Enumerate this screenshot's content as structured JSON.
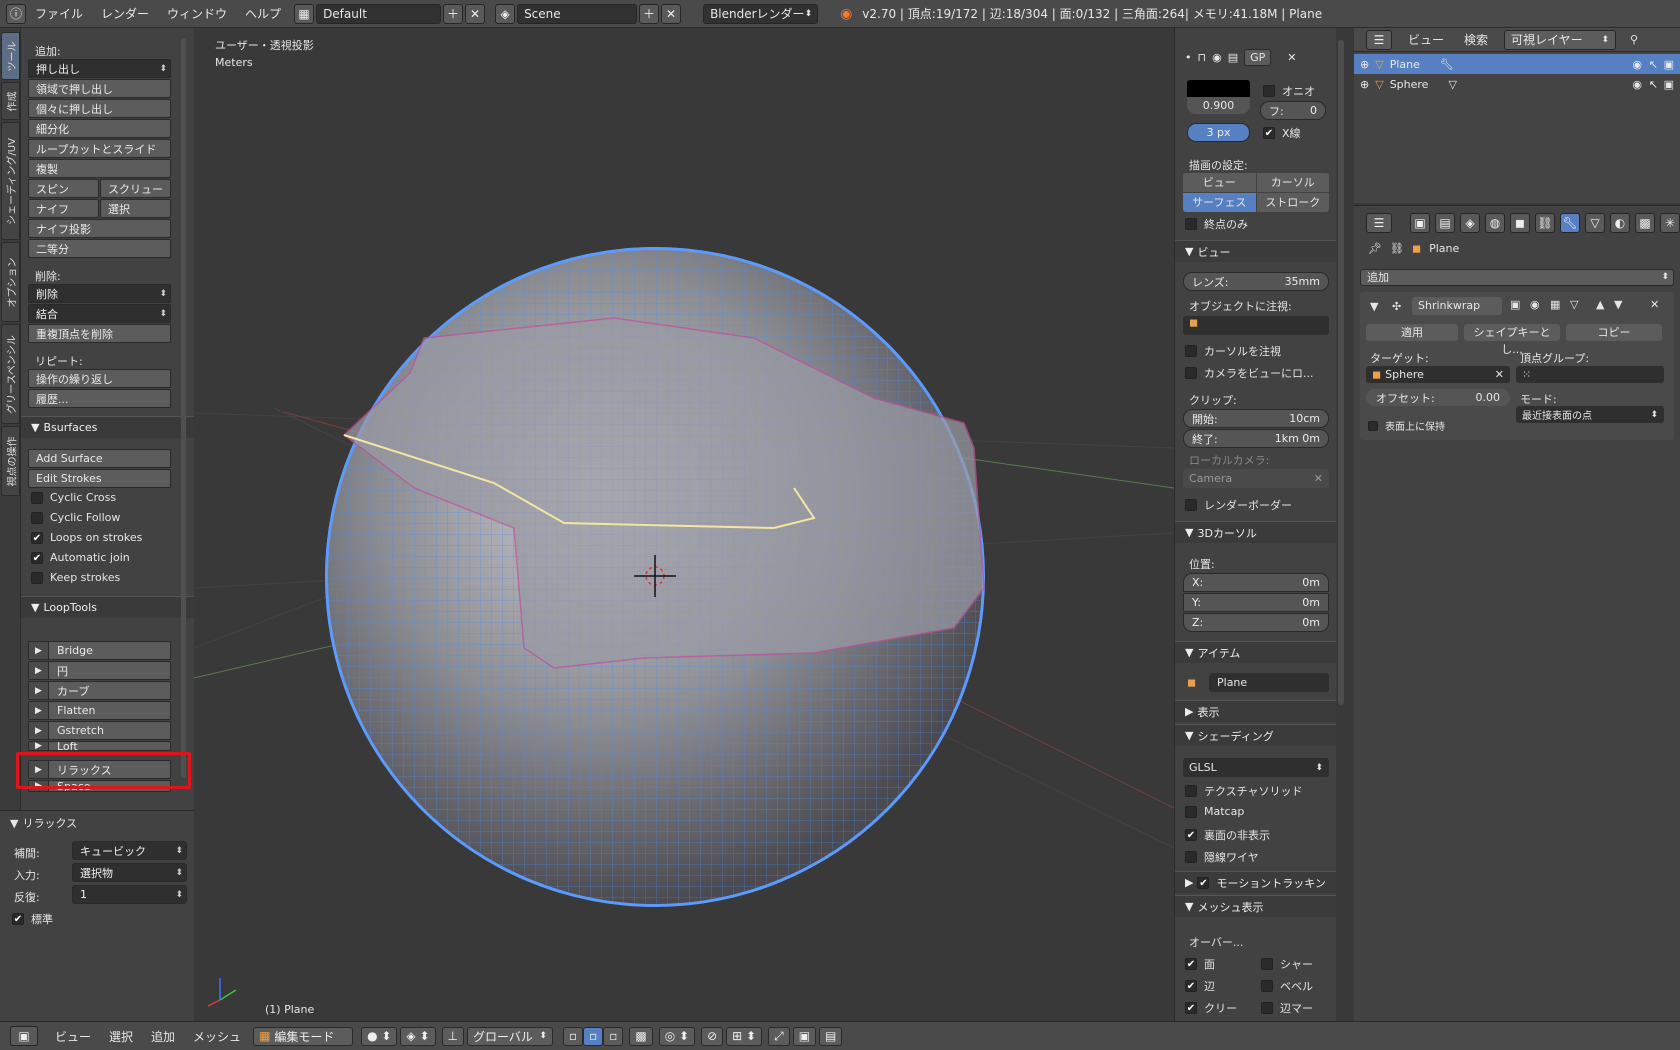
{
  "topbar": {
    "menus": [
      "ファイル",
      "レンダー",
      "ウィンドウ",
      "ヘルプ"
    ],
    "screen_layout": "Default",
    "scene": "Scene",
    "render_engine": "Blenderレンダー",
    "stats": "v2.70 | 頂点:19/172 | 辺:18/304 | 面:0/132 | 三角面:264| メモリ:41.18M | Plane"
  },
  "tabs": [
    "ツール",
    "作成",
    "シェーディング/UV",
    "オプション",
    "グリースペンシル",
    "視点の操作"
  ],
  "shelf": {
    "add_label": "追加:",
    "add_dropdown": "押し出し",
    "add_buttons": [
      "領域で押し出し",
      "個々に押し出し",
      "細分化",
      "ループカットとスライド",
      "複製"
    ],
    "spin": "スピン",
    "screw": "スクリュー",
    "knife": "ナイフ",
    "select": "選択",
    "knife_project": "ナイフ投影",
    "bisect": "二等分",
    "delete_label": "削除:",
    "delete_dropdown": "削除",
    "join_dropdown": "結合",
    "remove_doubles": "重複頂点を削除",
    "repeat_label": "リピート:",
    "repeat_last": "操作の繰り返し",
    "history": "履歴...",
    "bsurfaces_header": "Bsurfaces",
    "add_surface": "Add Surface",
    "edit_strokes": "Edit Strokes",
    "checks": [
      {
        "label": "Cyclic Cross",
        "checked": false
      },
      {
        "label": "Cyclic Follow",
        "checked": false
      },
      {
        "label": "Loops on strokes",
        "checked": true
      },
      {
        "label": "Automatic join",
        "checked": true
      },
      {
        "label": "Keep strokes",
        "checked": false
      }
    ],
    "looptools_header": "LoopTools",
    "looptools": [
      "Bridge",
      "円",
      "カーブ",
      "Flatten",
      "Gstretch",
      "Loft",
      "リラックス",
      "Space"
    ]
  },
  "operator": {
    "header": "リラックス",
    "interp_label": "補間:",
    "interp_value": "キュービック",
    "input_label": "入力:",
    "input_value": "選択物",
    "iter_label": "反復:",
    "iter_value": "1",
    "regular_label": "標準"
  },
  "viewport": {
    "view_name": "ユーザー・透視投影",
    "units": "Meters",
    "object_label": "(1) Plane"
  },
  "npanel": {
    "gp_label": "GP",
    "opacity": "0.900",
    "onion": "オニオ",
    "frames_label": "フ:",
    "frames_value": "0",
    "thickness": "3 px",
    "xray": "X線",
    "draw_settings": "描画の設定:",
    "view_btn": "ビュー",
    "cursor_btn": "カーソル",
    "surface_btn": "サーフェス",
    "stroke_btn": "ストローク",
    "endpoints": "終点のみ",
    "view_header": "ビュー",
    "lens_label": "レンズ:",
    "lens_value": "35mm",
    "lock_object": "オブジェクトに注視:",
    "lock_cursor": "カーソルを注視",
    "lock_camera": "カメラをビューにロ...",
    "clip_label": "クリップ:",
    "clip_start_label": "開始:",
    "clip_start": "10cm",
    "clip_end_label": "終了:",
    "clip_end": "1km 0m",
    "local_camera": "ローカルカメラ:",
    "camera": "Camera",
    "render_border": "レンダーボーダー",
    "cursor_header": "3Dカーソル",
    "location": "位置:",
    "x_label": "X:",
    "x": "0m",
    "y_label": "Y:",
    "y": "0m",
    "z_label": "Z:",
    "z": "0m",
    "item_header": "アイテム",
    "item_name": "Plane",
    "display_header": "表示",
    "shading_header": "シェーディング",
    "shading_mode": "GLSL",
    "textured_solid": "テクスチャソリッド",
    "matcap": "Matcap",
    "backface": "裏面の非表示",
    "hidden_wire": "隠線ワイヤ",
    "motion_tracking": "モーショントラッキン",
    "mesh_display": "メッシュ表示",
    "overlay": "オーバー...",
    "faces": "面",
    "sharp": "シャー",
    "edges": "辺",
    "bevel": "ベベル",
    "crease": "クリー",
    "edge_marks": "辺マー"
  },
  "outliner": {
    "view": "ビュー",
    "search": "検索",
    "filter": "可視レイヤー",
    "objects": [
      "Plane",
      "Sphere"
    ]
  },
  "props": {
    "object": "Plane",
    "add_modifier": "追加",
    "modifier_name": "Shrinkwrap",
    "apply": "適用",
    "shapekey": "シェイプキーとし...",
    "copy": "コピー",
    "target_label": "ターゲット:",
    "target": "Sphere",
    "vgroup_label": "頂点グループ:",
    "offset_label": "オフセット:",
    "offset": "0.00",
    "mode_label": "モード:",
    "mode": "最近接表面の点",
    "keep_above": "表面上に保持"
  },
  "bottombar": {
    "menus": [
      "ビュー",
      "選択",
      "追加",
      "メッシュ"
    ],
    "mode": "編集モード",
    "orientation": "グローバル"
  },
  "colors": {
    "accent": "#5680c2",
    "highlight": "#e0141c",
    "wire": "#4a8cf0"
  }
}
